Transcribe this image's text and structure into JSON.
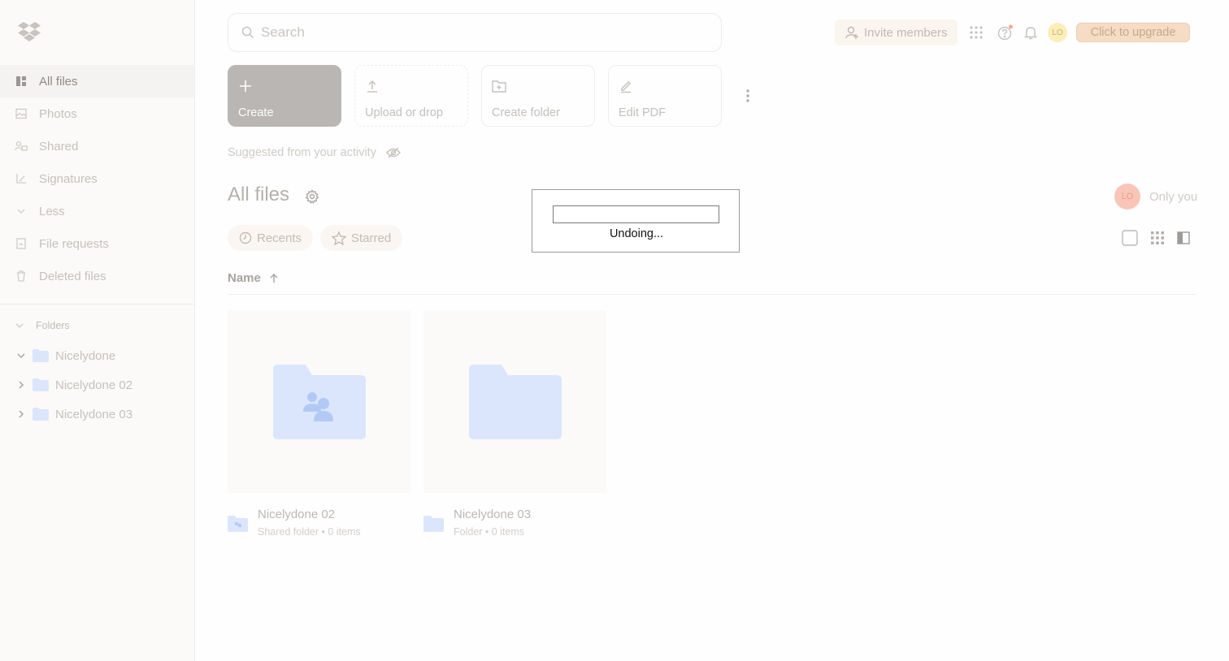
{
  "app": {
    "brand_icon": "dropbox-logo-icon",
    "accent_color": "#0061fe"
  },
  "sidebar": {
    "items": [
      {
        "label": "All files",
        "icon": "all-files-icon",
        "active": true
      },
      {
        "label": "Photos",
        "icon": "photos-icon",
        "active": false
      },
      {
        "label": "Shared",
        "icon": "shared-icon",
        "active": false
      },
      {
        "label": "Signatures",
        "icon": "signatures-icon",
        "active": false
      },
      {
        "label": "Less",
        "icon": "chevron-down-icon",
        "active": false
      },
      {
        "label": "File requests",
        "icon": "file-requests-icon",
        "active": false
      },
      {
        "label": "Deleted files",
        "icon": "trash-icon",
        "active": false
      }
    ],
    "folders_heading": "Folders",
    "folders": [
      {
        "label": "Nicelydone",
        "expanded": true
      },
      {
        "label": "Nicelydone 02",
        "expanded": false
      },
      {
        "label": "Nicelydone 03",
        "expanded": false
      }
    ]
  },
  "header": {
    "search_placeholder": "Search",
    "invite_label": "Invite members",
    "avatar_initials": "LO",
    "upgrade_label": "Click to upgrade"
  },
  "actions": {
    "create": "Create",
    "upload": "Upload or drop",
    "create_folder": "Create folder",
    "edit_pdf": "Edit PDF"
  },
  "suggested_label": "Suggested from your activity",
  "main": {
    "title": "All files",
    "owner_initials": "LO",
    "owner_label": "Only you",
    "chips": {
      "recents": "Recents",
      "starred": "Starred"
    },
    "sort_column": "Name",
    "files": [
      {
        "name": "Nicelydone 02",
        "desc": "Shared folder • 0 items",
        "type": "shared-folder"
      },
      {
        "name": "Nicelydone 03",
        "desc": "Folder • 0 items",
        "type": "folder"
      }
    ]
  },
  "dialog": {
    "message": "Undoing...",
    "progress": 0
  }
}
